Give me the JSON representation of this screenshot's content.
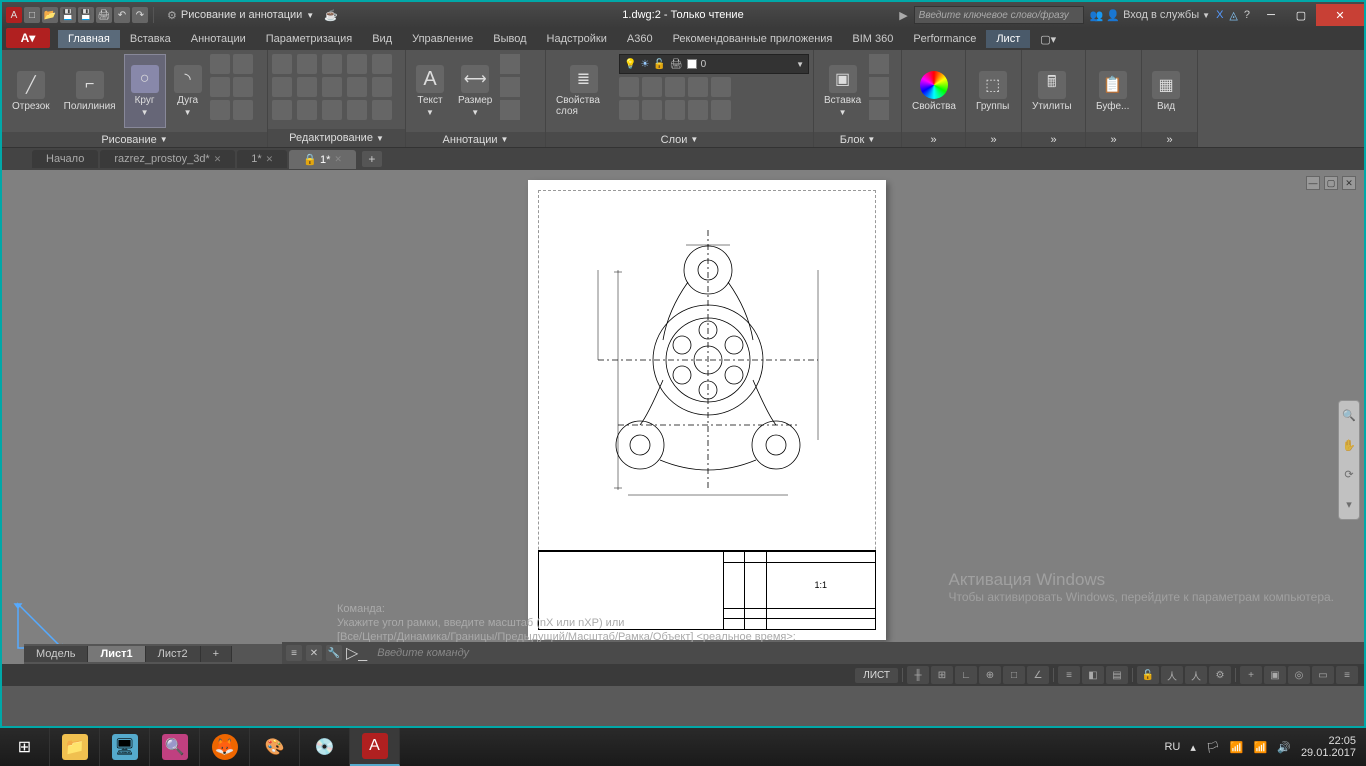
{
  "titlebar": {
    "workspace_label": "Рисование и аннотации",
    "title": "1.dwg:2 - Только чтение",
    "search_placeholder": "Введите ключевое слово/фразу",
    "login_label": "Вход в службы"
  },
  "ribbon_tabs": [
    "Главная",
    "Вставка",
    "Аннотации",
    "Параметризация",
    "Вид",
    "Управление",
    "Вывод",
    "Надстройки",
    "A360",
    "Рекомендованные приложения",
    "BIM 360",
    "Performance",
    "Лист"
  ],
  "panels": {
    "draw": {
      "title": "Рисование",
      "btns": {
        "line": "Отрезок",
        "polyline": "Полилиния",
        "circle": "Круг",
        "arc": "Дуга"
      }
    },
    "modify": {
      "title": "Редактирование"
    },
    "annot": {
      "title": "Аннотации",
      "btns": {
        "text": "Текст",
        "dim": "Размер"
      }
    },
    "layers": {
      "title": "Слои",
      "btn": "Свойства слоя",
      "combo_value": "0"
    },
    "block": {
      "title": "Блок",
      "btn": "Вставка"
    },
    "props": {
      "title": "Свойства"
    },
    "groups": {
      "title": "Группы"
    },
    "utils": {
      "title": "Утилиты"
    },
    "clip": {
      "title": "Буфе..."
    },
    "view": {
      "title": "Вид"
    }
  },
  "doc_tabs": [
    {
      "label": "Начало",
      "active": false,
      "close": false
    },
    {
      "label": "razrez_prostoy_3d*",
      "active": false,
      "close": true
    },
    {
      "label": "1*",
      "active": false,
      "close": true
    },
    {
      "label": "🔒 1*",
      "active": true,
      "close": true
    }
  ],
  "cmd": {
    "l1": "Команда:",
    "l2": "Укажите угол рамки, введите масштаб (nX или nXP) или",
    "l3": "[Все/Центр/Динамика/Границы/Предыдущий/Масштаб/Рамка/Объект] <реальное время>:",
    "prompt": "Введите команду"
  },
  "layout_tabs": [
    "Модель",
    "Лист1",
    "Лист2"
  ],
  "status": {
    "mode": "ЛИСТ"
  },
  "activation": {
    "t1": "Активация Windows",
    "t2": "Чтобы активировать Windows, перейдите к параметрам компьютера."
  },
  "titleblock": {
    "scale": "1:1"
  },
  "tray": {
    "lang": "RU",
    "time": "22:05",
    "date": "29.01.2017"
  }
}
